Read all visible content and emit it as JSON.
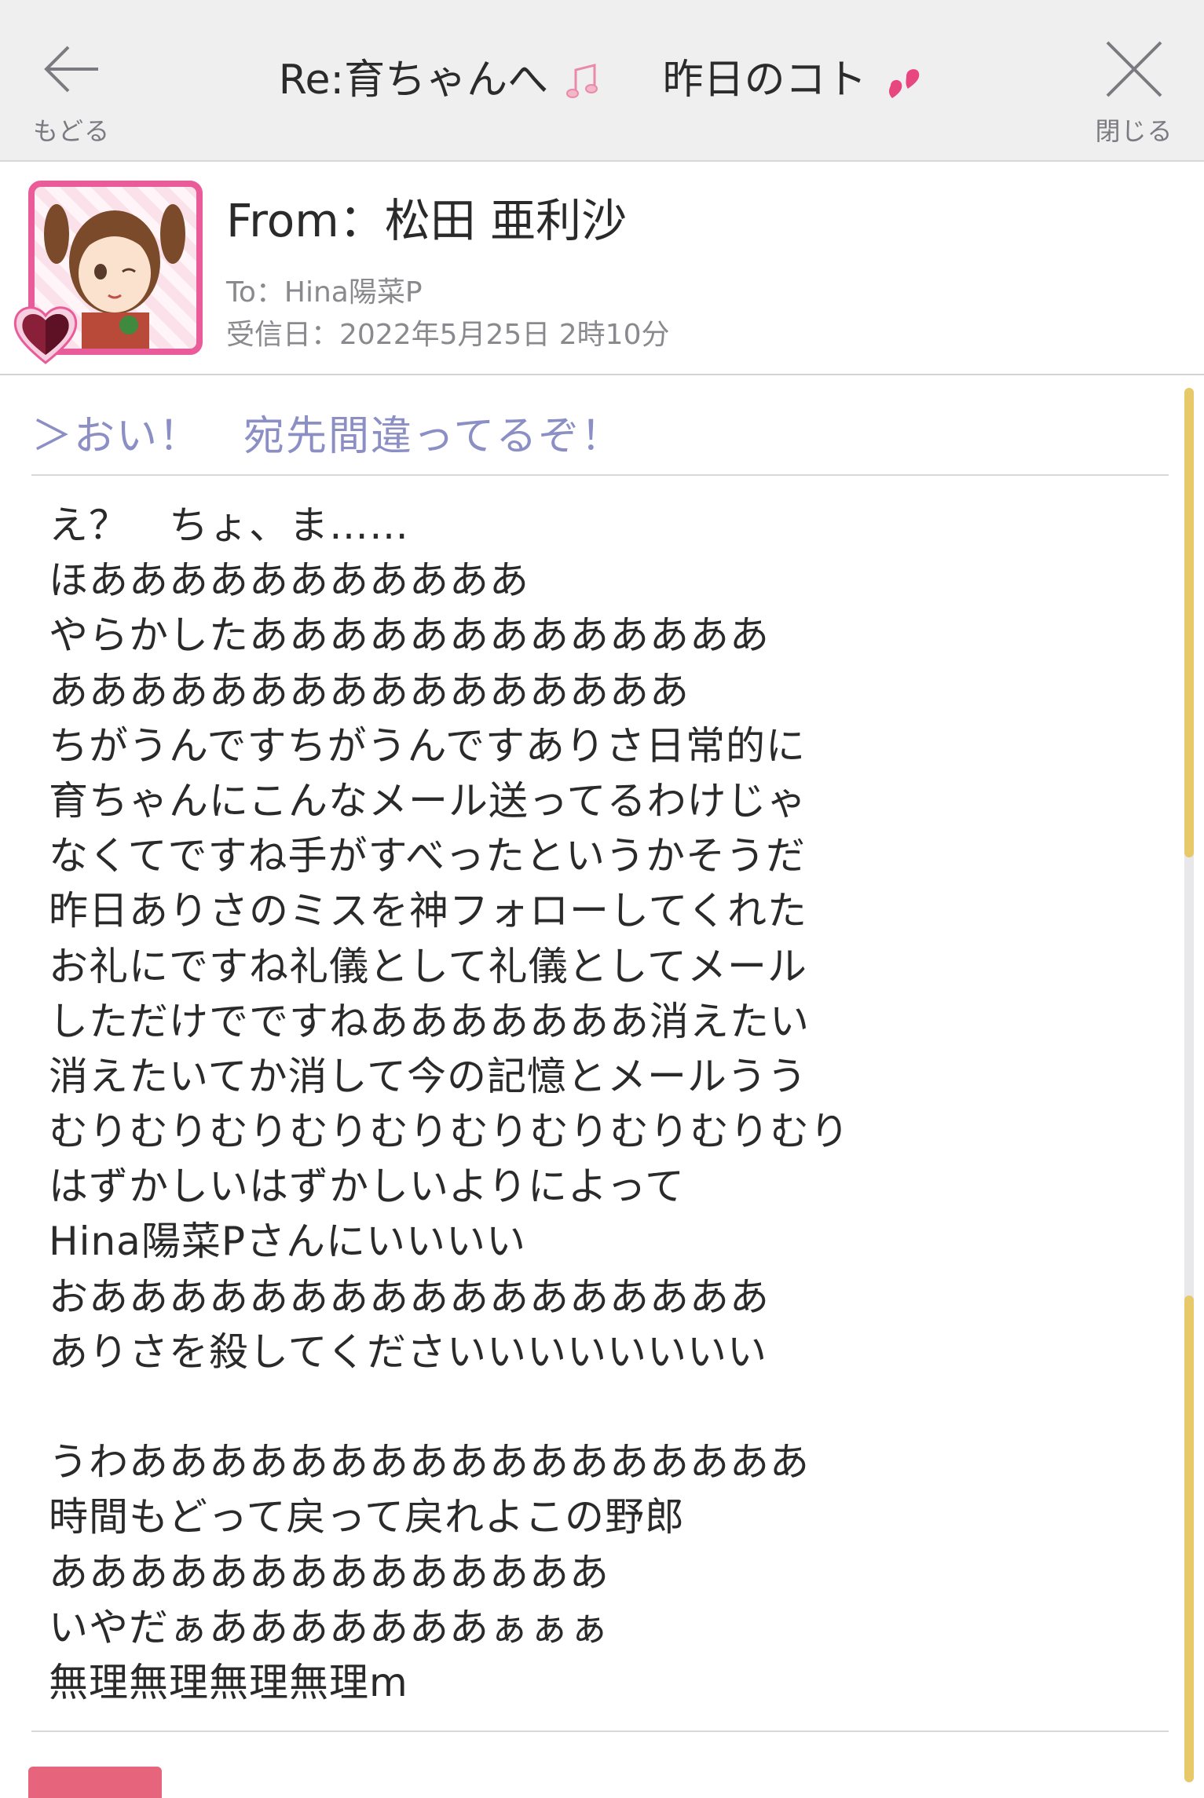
{
  "header": {
    "back_label": "もどる",
    "close_label": "閉じる",
    "title": "Re:育ちゃんへ",
    "title_suffix": "昨日のコト"
  },
  "sender": {
    "from": "From：松田 亜利沙",
    "to": "To：Hina陽菜P",
    "received": "受信日：2022年5月25日 2時10分"
  },
  "quote": "＞おい！　宛先間違ってるぞ！",
  "body_lines": [
    "え？　ちょ、ま……",
    "ほあああああああああああ",
    "やらかしたあああああああああああああ",
    "ああああああああああああああああ",
    "ちがうんですちがうんですありさ日常的に",
    "育ちゃんにこんなメール送ってるわけじゃ",
    "なくてですね手がすべったというかそうだ",
    "昨日ありさのミスを神フォローしてくれた",
    "お礼にですね礼儀として礼儀としてメール",
    "しただけでですねあああああああ消えたい",
    "消えたいてか消して今の記憶とメールうう",
    "むりむりむりむりむりむりむりむりむりむり",
    "はずかしいはずかしいよりによって",
    "Hina陽菜Pさんにいいいい",
    "おあああああああああああああああああ",
    "ありさを殺してくださいいいいいいいい",
    "",
    "うわあああああああああああああああああ",
    "時間もどって戻って戻れよこの野郎",
    "ああああああああああああああ",
    "いやだぁあああああああぁぁぁ",
    "無理無理無理無理m"
  ],
  "icons": {
    "back": "back-arrow-icon",
    "close": "close-icon",
    "title_note": "music-note-icon",
    "title_hearts": "two-hearts-icon",
    "avatar_badge": "heart-badge-icon"
  },
  "colors": {
    "header_bg": "#efeff0",
    "quote": "#8c8fc4",
    "avatar_border": "#ea5b9a",
    "scroll_thumb": "#e8c96a"
  }
}
